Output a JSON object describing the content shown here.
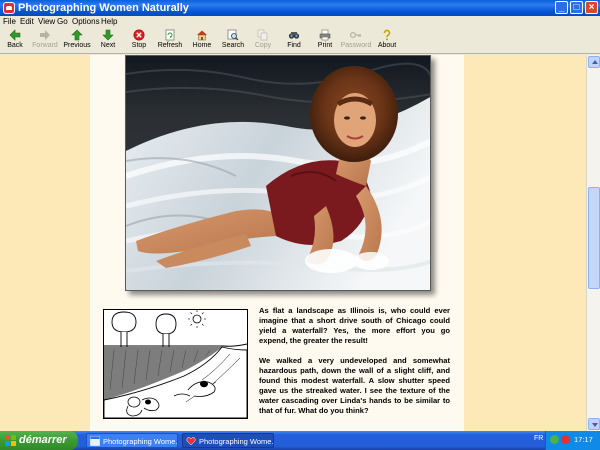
{
  "window": {
    "title": "Photographing Women Naturally",
    "controls": {
      "minimize": "_",
      "maximize": "□",
      "close": "×"
    }
  },
  "menu": [
    "File",
    "Edit",
    "View",
    "Go",
    "Options",
    "Help"
  ],
  "toolbar": [
    {
      "label": "Back",
      "icon": "back-arrow-icon",
      "enabled": true
    },
    {
      "label": "Forward",
      "icon": "forward-arrow-icon",
      "enabled": false
    },
    {
      "label": "Previous",
      "icon": "up-arrow-icon",
      "enabled": true
    },
    {
      "label": "Next",
      "icon": "down-arrow-icon",
      "enabled": true
    },
    {
      "label": "Stop",
      "icon": "stop-icon",
      "enabled": true
    },
    {
      "label": "Refresh",
      "icon": "refresh-icon",
      "enabled": true
    },
    {
      "label": "Home",
      "icon": "home-icon",
      "enabled": true
    },
    {
      "label": "Search",
      "icon": "search-icon",
      "enabled": true
    },
    {
      "label": "Copy",
      "icon": "copy-icon",
      "enabled": false
    },
    {
      "label": "Find",
      "icon": "find-icon",
      "enabled": true
    },
    {
      "label": "Print",
      "icon": "print-icon",
      "enabled": true
    },
    {
      "label": "Password",
      "icon": "key-icon",
      "enabled": false
    },
    {
      "label": "About",
      "icon": "about-icon",
      "enabled": true
    }
  ],
  "article": {
    "paragraph1": "As flat a landscape as Illinois is, who could ever imagine that a short drive south of Chicago could yield a waterfall? Yes, the more effort you go expend, the greater the result!",
    "paragraph2": "We walked a very undeveloped and somewhat hazardous path, down the wall of a slight cliff, and found this modest waterfall.  A slow shutter speed gave us the streaked water. I see the texture of the water cascading over Linda's hands to be similar to that of fur. What do you think?"
  },
  "taskbar": {
    "start_label": "démarrer",
    "tasks": [
      {
        "label": "Photographing Wome..."
      },
      {
        "label": "Photographing Wome..."
      }
    ],
    "language": "FR",
    "clock": "17:17"
  },
  "colors": {
    "page_background": "#fde8b8",
    "content_background": "#fffaf0",
    "titlebar": "#0556d6",
    "start_button": "#3c9a33"
  },
  "scrollbar": {
    "position_fraction": 0.35
  }
}
